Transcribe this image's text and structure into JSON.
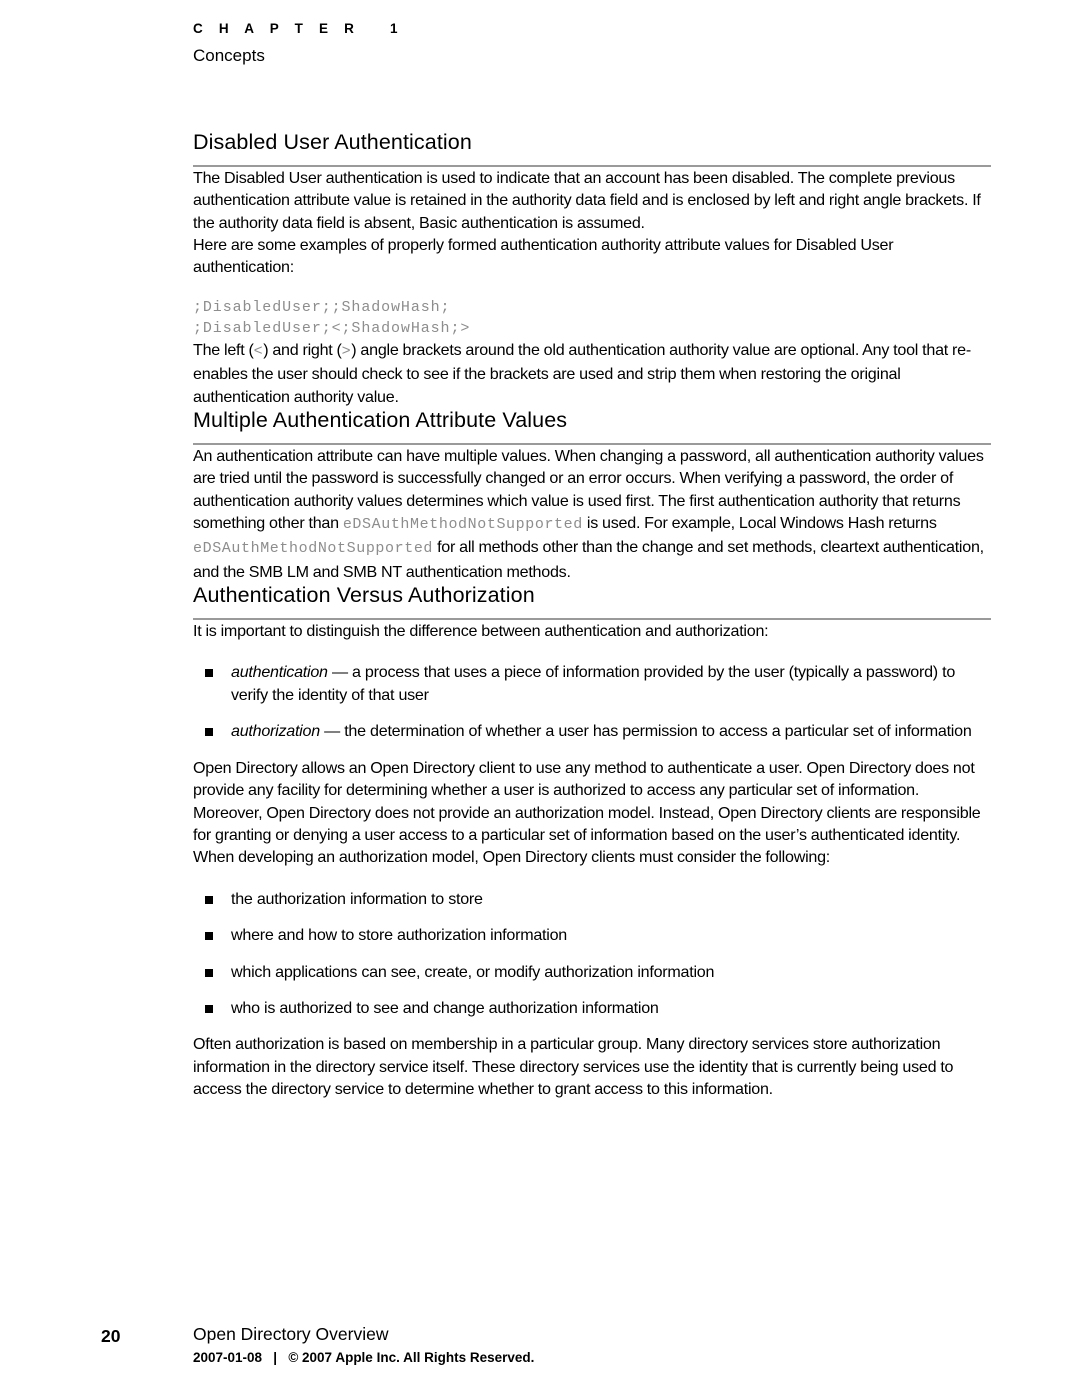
{
  "header": {
    "chapter_label": "C H A P T E R   1",
    "chapter_name": "Concepts"
  },
  "sections": [
    {
      "heading": "Disabled User Authentication",
      "paragraph_1": "The Disabled User authentication is used to indicate that an account has been disabled. The complete previous authentication attribute value is retained in the authority data field and is enclosed by left and right angle brackets. If the authority data field is absent, Basic authentication is assumed.",
      "paragraph_2": "Here are some examples of properly formed authentication authority attribute values for Disabled User authentication:",
      "code_line_1": ";DisabledUser;;ShadowHash;",
      "code_line_2": ";DisabledUser;<;ShadowHash;>",
      "paragraph_3_a": "The left (",
      "paragraph_3_code_left": "<",
      "paragraph_3_b": ") and right (",
      "paragraph_3_code_right": ">",
      "paragraph_3_c": ") angle brackets around the old authentication authority value are optional. Any tool that re-enables the user should check to see if the brackets are used and strip them when restoring the original authentication authority value."
    },
    {
      "heading": "Multiple Authentication Attribute Values",
      "paragraph_a": "An authentication attribute can have multiple values. When changing a password, all authentication authority values are tried until the password is successfully changed or an error occurs. When verifying a password, the order of authentication authority values determines which value is used first. The first authentication authority that returns something other than ",
      "code_1": "eDSAuthMethodNotSupported",
      "paragraph_b": " is used. For example, Local Windows Hash returns ",
      "code_2": "eDSAuthMethodNotSupported",
      "paragraph_c": " for all methods other than the change and set methods, cleartext authentication, and the SMB LM and SMB NT authentication methods."
    },
    {
      "heading": "Authentication Versus Authorization",
      "intro": "It is important to distinguish the difference between authentication and authorization:",
      "definitions": [
        {
          "term": "authentication",
          "text": " — a process that uses a piece of information provided by the user (typically a password) to verify the identity of that user"
        },
        {
          "term": "authorization",
          "text": " — the determination of whether a user has permission to access a particular set of information"
        }
      ],
      "paragraph_after_defs": "Open Directory allows an Open Directory client to use any method to authenticate a user. Open Directory does not provide any facility for determining whether a user is authorized to access any particular set of information. Moreover, Open Directory does not provide an authorization model. Instead, Open Directory clients are responsible for granting or denying a user access to a particular set of information based on the user’s authenticated identity.",
      "paragraph_lead_in": "When developing an authorization model, Open Directory clients must consider the following:",
      "considerations": [
        "the authorization information to store",
        "where and how to store authorization information",
        "which applications can see, create, or modify authorization information",
        "who is authorized to see and change authorization information"
      ],
      "paragraph_closing": "Often authorization is based on membership in a particular group. Many directory services store authorization information in the directory service itself. These directory services use the identity that is currently being used to access the directory service to determine whether to grant access to this information."
    }
  ],
  "footer": {
    "page_number": "20",
    "document_title": "Open Directory Overview",
    "legal": "2007-01-08   |   © 2007 Apple Inc. All Rights Reserved."
  },
  "colors": {
    "text": "#000000",
    "rule": "#9a9a9a",
    "code": "#8d8d8d",
    "background": "#ffffff"
  }
}
